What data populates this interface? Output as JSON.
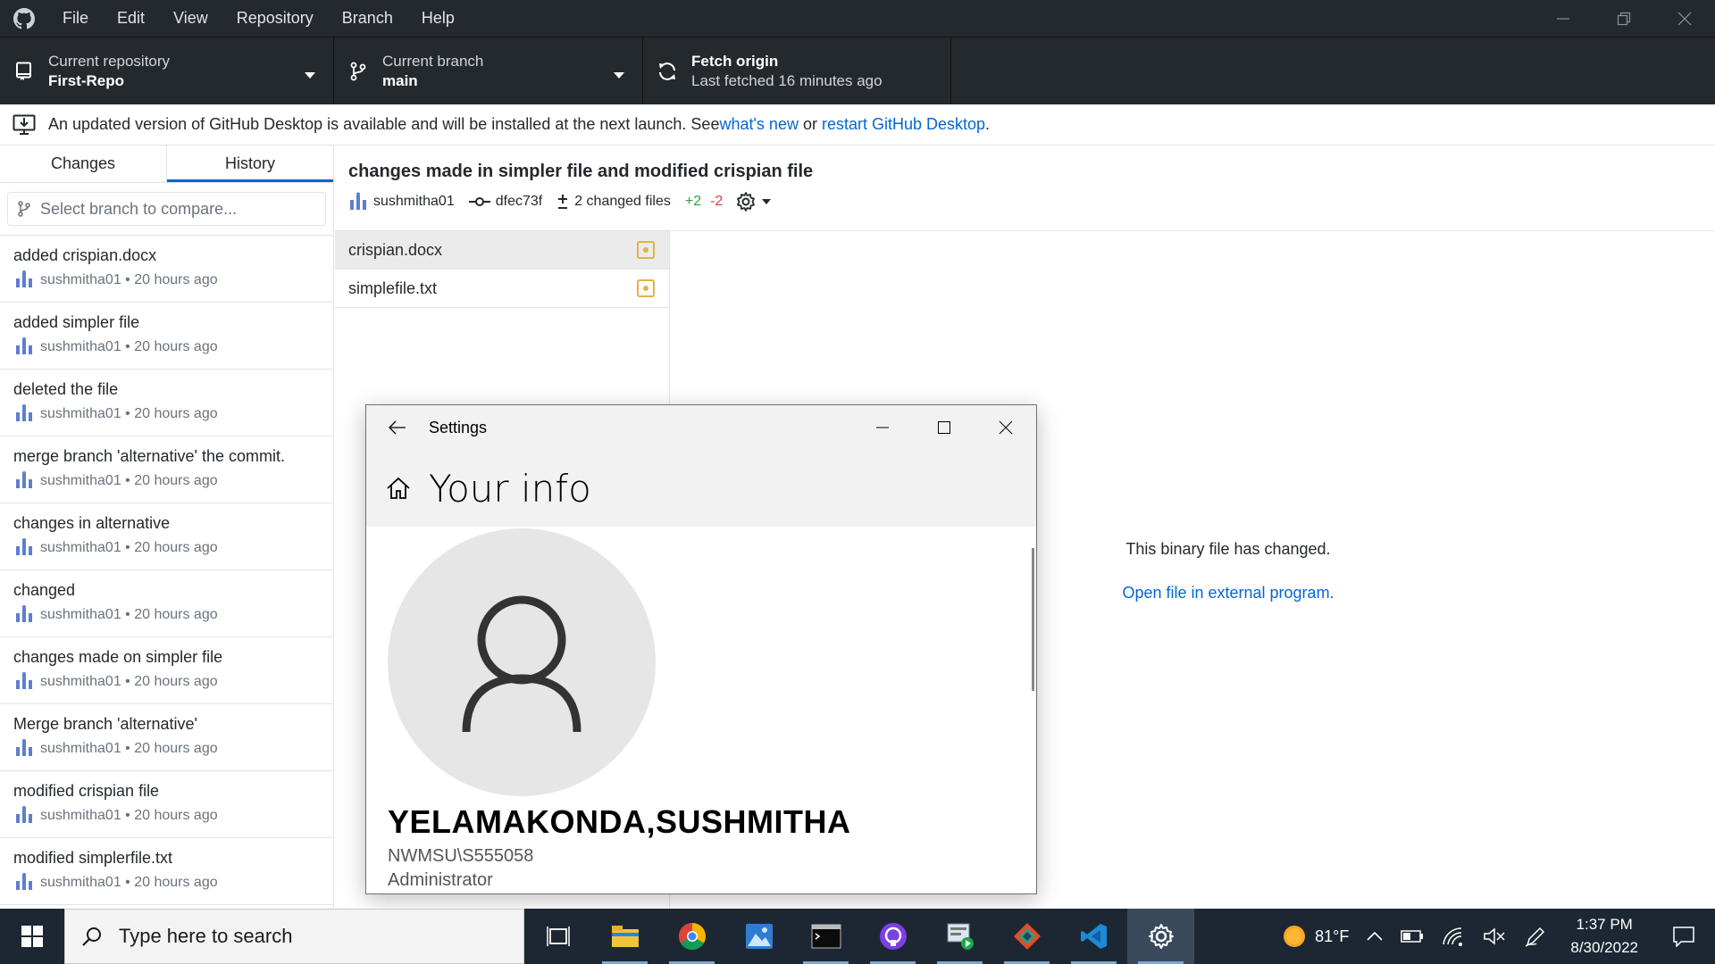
{
  "menubar": {
    "items": [
      "File",
      "Edit",
      "View",
      "Repository",
      "Branch",
      "Help"
    ]
  },
  "toolbar": {
    "repo": {
      "small": "Current repository",
      "big": "First-Repo"
    },
    "branch": {
      "small": "Current branch",
      "big": "main"
    },
    "fetch": {
      "big": "Fetch origin",
      "small": "Last fetched 16 minutes ago"
    }
  },
  "banner": {
    "text": "An updated version of GitHub Desktop is available and will be installed at the next launch. See ",
    "link1": "what's new",
    "mid": " or ",
    "link2": "restart GitHub Desktop",
    "end": "."
  },
  "sidebar": {
    "tabs": [
      "Changes",
      "History"
    ],
    "compare_placeholder": "Select branch to compare...",
    "commits": [
      {
        "summary": "added crispian.docx",
        "meta": "sushmitha01 • 20 hours ago"
      },
      {
        "summary": "added simpler file",
        "meta": "sushmitha01 • 20 hours ago"
      },
      {
        "summary": "deleted the file",
        "meta": "sushmitha01 • 20 hours ago"
      },
      {
        "summary": "merge branch 'alternative' the commit.",
        "meta": "sushmitha01 • 20 hours ago"
      },
      {
        "summary": "changes in alternative",
        "meta": "sushmitha01 • 20 hours ago"
      },
      {
        "summary": "changed",
        "meta": "sushmitha01 • 20 hours ago"
      },
      {
        "summary": "changes made on simpler file",
        "meta": "sushmitha01 • 20 hours ago"
      },
      {
        "summary": "Merge branch 'alternative'",
        "meta": "sushmitha01 • 20 hours ago"
      },
      {
        "summary": "modified crispian file",
        "meta": "sushmitha01 • 20 hours ago"
      },
      {
        "summary": "modified simplerfile.txt",
        "meta": "sushmitha01 • 20 hours ago"
      }
    ]
  },
  "commit": {
    "title": "changes made in simpler file and modified crispian file",
    "author": "sushmitha01",
    "sha": "dfec73f",
    "changed_files": "2 changed files",
    "added": "+2",
    "removed": "-2",
    "files": [
      {
        "name": "crispian.docx",
        "selected": true
      },
      {
        "name": "simplefile.txt",
        "selected": false
      }
    ],
    "binary_msg": "This binary file has changed.",
    "open_external": "Open file in external program."
  },
  "settings": {
    "window_title": "Settings",
    "header": "Your info",
    "name": "YELAMAKONDA,SUSHMITHA",
    "domain": "NWMSU\\S555058",
    "role": "Administrator"
  },
  "taskbar": {
    "search_placeholder": "Type here to search",
    "weather": "81°F",
    "time": "1:37 PM",
    "date": "8/30/2022"
  },
  "colors": {
    "titlebar": "#24292e",
    "accent": "#0366d6",
    "added": "#28a745",
    "removed": "#d73a49",
    "modified": "#e3b341",
    "taskbar": "#1c2733"
  }
}
